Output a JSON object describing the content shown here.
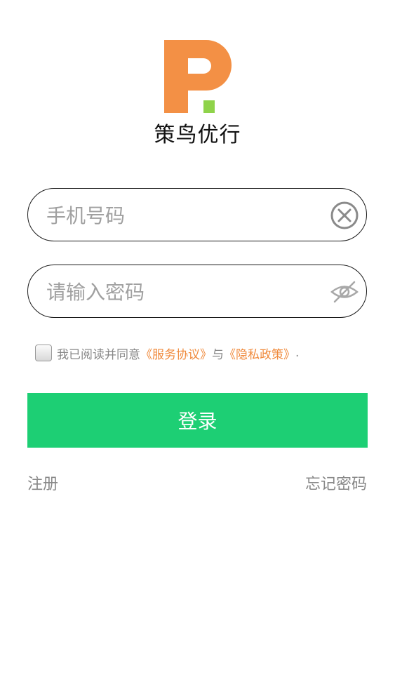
{
  "app": {
    "name": "策鸟优行",
    "logo_colors": {
      "primary": "#f39045",
      "accent": "#8fd34a"
    }
  },
  "phone_field": {
    "placeholder": "手机号码",
    "value": "",
    "clear_icon": "clear-circle-icon"
  },
  "password_field": {
    "placeholder": "请输入密码",
    "value": "",
    "visibility_icon": "eye-hidden-icon"
  },
  "agreement": {
    "checked": false,
    "prefix": "我已阅读并同意",
    "service_link": "《服务协议》",
    "conjunction": "与",
    "privacy_link": "《隐私政策》",
    "suffix": "."
  },
  "login_button": {
    "label": "登录",
    "color": "#1dcf74"
  },
  "links": {
    "register": "注册",
    "forgot_password": "忘记密码"
  }
}
